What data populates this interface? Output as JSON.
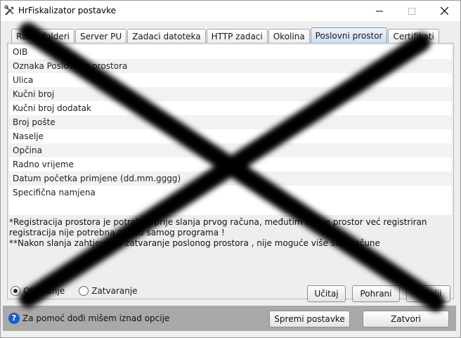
{
  "window": {
    "title": "HrFiskalizator postavke"
  },
  "tabs": [
    {
      "label": "Radni folderi",
      "active": false
    },
    {
      "label": "Server PU",
      "active": false
    },
    {
      "label": "Zadaci datoteka",
      "active": false
    },
    {
      "label": "HTTP zadaci",
      "active": false
    },
    {
      "label": "Okolina",
      "active": false
    },
    {
      "label": "Poslovni prostor",
      "active": true
    },
    {
      "label": "Certifikati",
      "active": false
    }
  ],
  "fields": [
    "OIB",
    "Oznaka Poslovnog prostora",
    "Ulica",
    "Kučni broj",
    "Kučni broj dodatak",
    "Broj pošte",
    "Naselje",
    "Opčina",
    "Radno vrijeme",
    "Datum početka primjene (dd.mm.gggg)",
    "Specifična namjena"
  ],
  "notes": {
    "line1": "*Registracija prostora je potrebna prije slanja prvog računa, međutim ako je prostor već registriran",
    "line2": "registracija nije potrebna za rad samog programa !",
    "line3": "**Nakon slanja zahtjeva za zatvaranje poslonog prostora , nije moguće više slati račune"
  },
  "radio": {
    "open_label": "Otvaranje",
    "close_label": "Zatvaranje",
    "selected": "open"
  },
  "buttons": {
    "load": "Učitaj",
    "save": "Pohrani",
    "send": "Pošalji",
    "save_settings": "Spremi postavke",
    "close": "Zatvori"
  },
  "footer": {
    "help_text": "Za pomoć dođi mišem iznad opcije",
    "help_icon": "question-icon"
  },
  "colors": {
    "active_tab": "#c9dcf1",
    "help_icon": "#1c5ec4",
    "bottom_bar": "#a9a9a9"
  }
}
